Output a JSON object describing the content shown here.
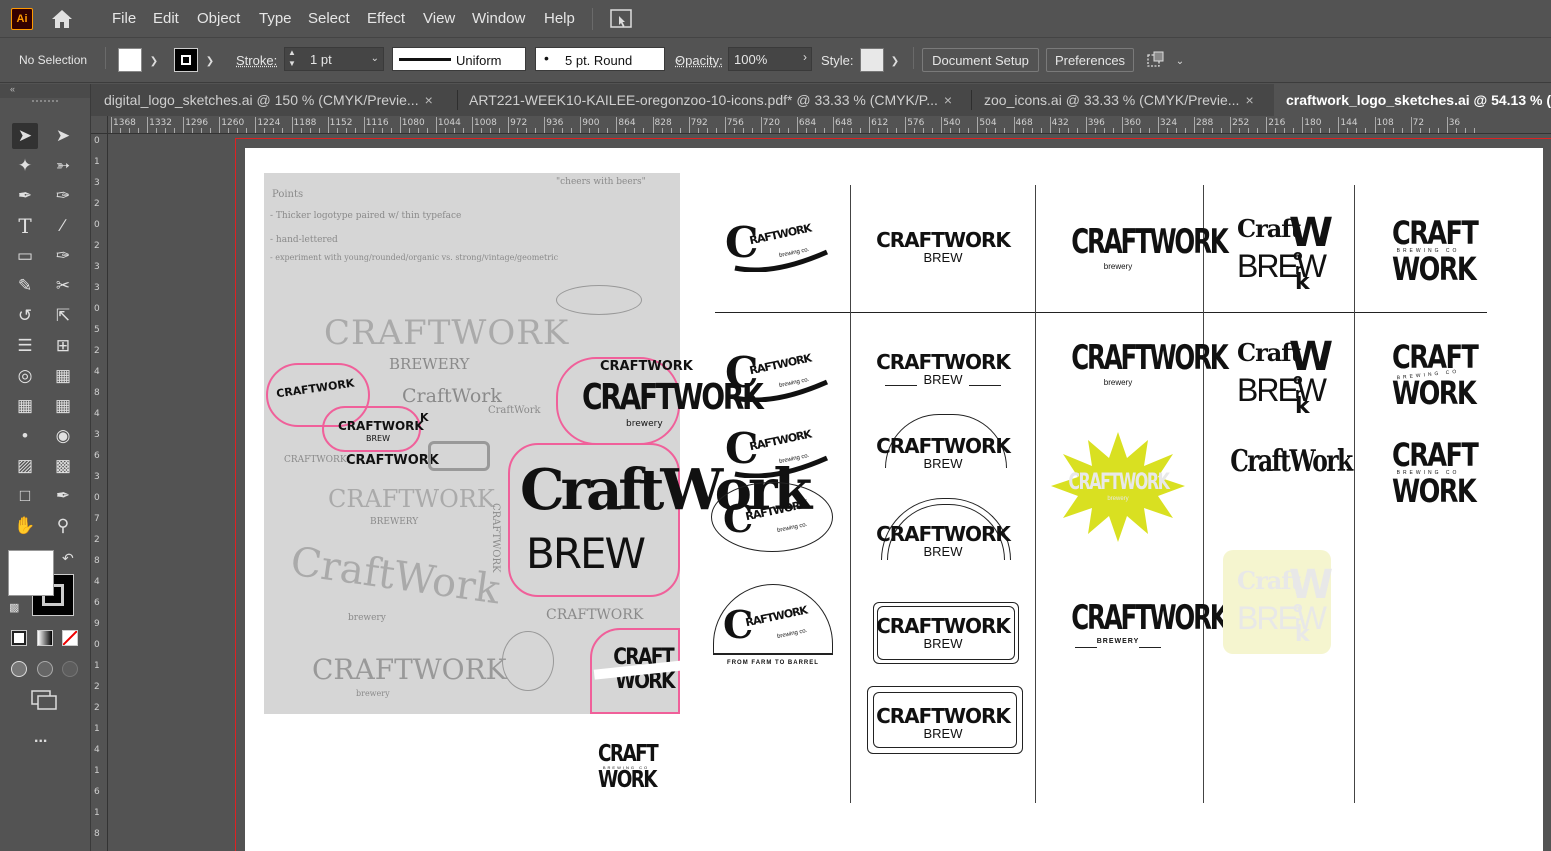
{
  "app": {
    "logo_text": "Ai",
    "accent": "#ff9a00"
  },
  "menu": [
    "File",
    "Edit",
    "Object",
    "Type",
    "Select",
    "Effect",
    "View",
    "Window",
    "Help"
  ],
  "control": {
    "selection": "No Selection",
    "stroke_label": "Stroke:",
    "stroke_value": "1 pt",
    "profile": "Uniform",
    "brush": "5 pt. Round",
    "opacity_label": "Opacity:",
    "opacity_value": "100%",
    "style_label": "Style:",
    "doc_setup": "Document Setup",
    "preferences": "Preferences"
  },
  "tabs": [
    {
      "label": "digital_logo_sketches.ai @ 150 % (CMYK/Previe...",
      "active": false
    },
    {
      "label": "ART221-WEEK10-KAILEE-oregonzoo-10-icons.pdf* @ 33.33 % (CMYK/P...",
      "active": false
    },
    {
      "label": "zoo_icons.ai @ 33.33 % (CMYK/Previe...",
      "active": false
    },
    {
      "label": "craftwork_logo_sketches.ai @ 54.13 % (C",
      "active": true
    }
  ],
  "ruler_top": [
    "1368",
    "1332",
    "1296",
    "1260",
    "1224",
    "1188",
    "1152",
    "1116",
    "1080",
    "1044",
    "1008",
    "972",
    "936",
    "900",
    "864",
    "828",
    "792",
    "756",
    "720",
    "684",
    "648",
    "612",
    "576",
    "540",
    "504",
    "468",
    "432",
    "396",
    "360",
    "324",
    "288",
    "252",
    "216",
    "180",
    "144",
    "108",
    "72",
    "36"
  ],
  "ruler_left": [
    "0",
    "1",
    "3",
    "2",
    "0",
    "2",
    "3",
    "3",
    "0",
    "5",
    "2",
    "4",
    "8",
    "4",
    "3",
    "6",
    "3",
    "0",
    "7",
    "2",
    "8",
    "4",
    "6",
    "9",
    "0",
    "1",
    "2",
    "2",
    "1",
    "4",
    "1",
    "6",
    "1",
    "8"
  ],
  "tools": [
    "selection-tool",
    "direct-selection-tool",
    "magic-wand-tool",
    "lasso-tool",
    "pen-tool",
    "curvature-tool",
    "type-tool",
    "line-tool",
    "rectangle-tool",
    "paintbrush-tool",
    "pencil-tool",
    "scissors-tool",
    "rotate-tool",
    "scale-tool",
    "warp-tool",
    "free-transform-tool",
    "shape-builder-tool",
    "perspective-grid-tool",
    "mesh-tool",
    "gradient-tool",
    "eyedropper-tool",
    "blend-tool",
    "symbol-sprayer-tool",
    "column-graph-tool",
    "artboard-tool",
    "slice-tool",
    "hand-tool",
    "zoom-tool"
  ],
  "more_tools": "...",
  "sketch": {
    "notes": [
      "Points",
      "- Thicker logotype paired w/ thin typeface",
      "- hand-lettered",
      "- experiment with young/rounded/organic vs. strong/vintage/geometric"
    ],
    "quote": "\"cheers with beers\"",
    "words": {
      "craftwork": "CRAFTWORK",
      "craftwork_mixed": "CraftWork",
      "brewery": "BREWERY",
      "brewery_lower": "brewery",
      "brew": "BREW",
      "craft": "CRAFT",
      "work": "WORK",
      "k": "K"
    }
  },
  "logos": {
    "craftwork": "CRAFTWORK",
    "raftwork": "RAFTWORK",
    "c": "C",
    "brew": "BREW",
    "brewery": "brewery",
    "brewery_caps": "BREWERY",
    "brewing_co": "brewing co.",
    "brewing_co_caps": "BREWING CO",
    "craft": "CRAFT",
    "work": "WORK",
    "craft_stack": "Craft",
    "w": "W",
    "o": "o",
    "r": "r",
    "k": "k",
    "craftwork_mixed": "CraftWork",
    "farm": "FROM FARM TO BARREL",
    "starburst_color": "#d9e021",
    "cream_color": "#f5f5cf"
  }
}
